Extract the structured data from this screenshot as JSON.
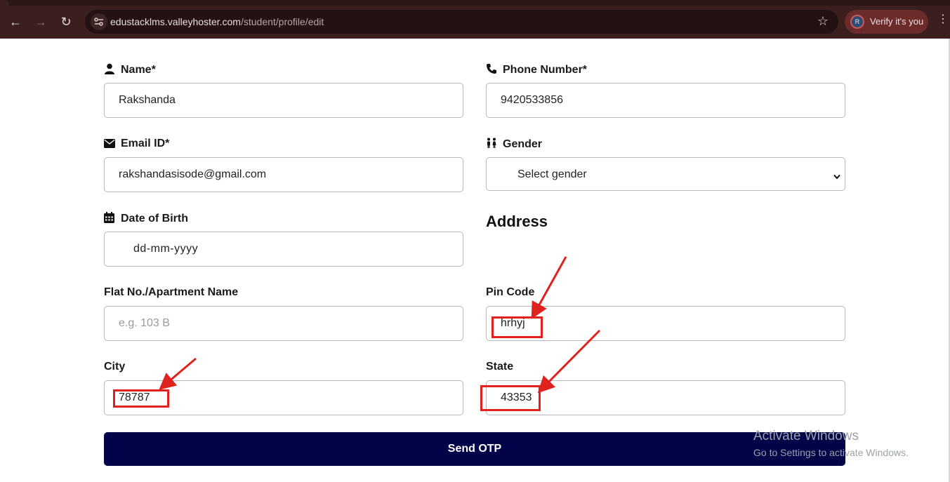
{
  "browser": {
    "url_host": "edustacklms.valleyhoster.com",
    "url_path": "/student/profile/edit",
    "profile_initial": "R",
    "profile_label": "Verify it's you"
  },
  "form": {
    "name": {
      "label": "Name*",
      "value": "Rakshanda"
    },
    "phone": {
      "label": "Phone Number*",
      "value": "9420533856"
    },
    "email": {
      "label": "Email ID*",
      "value": "rakshandasisode@gmail.com"
    },
    "gender": {
      "label": "Gender",
      "value": "Select gender"
    },
    "dob": {
      "label": "Date of Birth",
      "value": "dd-mm-yyyy"
    },
    "address_title": "Address",
    "flat": {
      "label": "Flat No./Apartment Name",
      "placeholder": "e.g. 103 B"
    },
    "pin": {
      "label": "Pin Code",
      "value": "hrhyj"
    },
    "city": {
      "label": "City",
      "value": "78787"
    },
    "state": {
      "label": "State",
      "value": "43353"
    },
    "submit_label": "Send OTP"
  },
  "watermark": {
    "line1": "Activate Windows",
    "line2": "Go to Settings to activate Windows."
  },
  "colors": {
    "chrome_bg": "#3b1f1f",
    "button_bg": "#03034a",
    "annotation": "#e0221f"
  }
}
